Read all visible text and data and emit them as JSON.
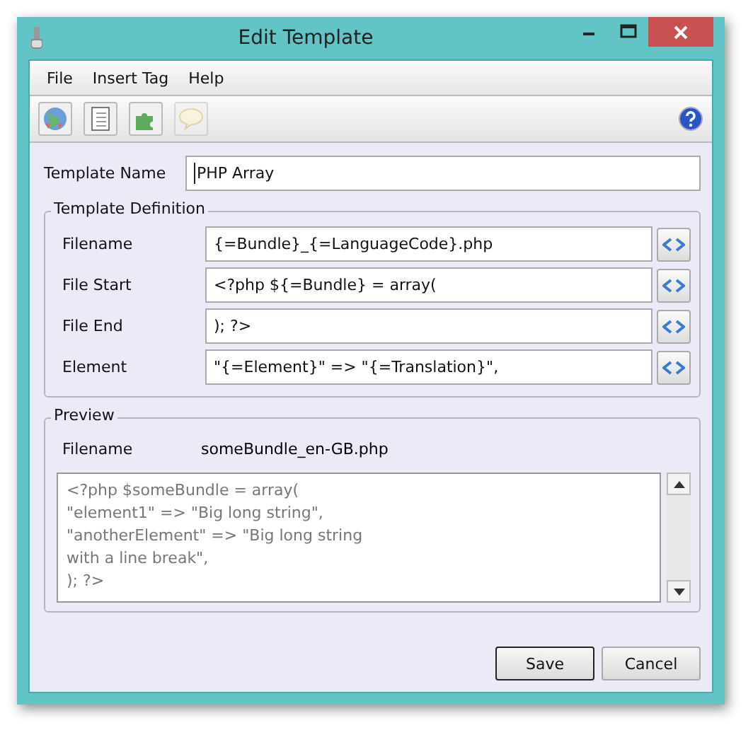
{
  "window": {
    "title": "Edit Template"
  },
  "menu": [
    "File",
    "Insert Tag",
    "Help"
  ],
  "toolbar": [
    {
      "kind": "globe",
      "disabled": false
    },
    {
      "kind": "notes",
      "disabled": false
    },
    {
      "kind": "puzzle",
      "disabled": false
    },
    {
      "kind": "speech",
      "disabled": true
    }
  ],
  "template_name": {
    "label": "Template Name",
    "value": "PHP Array"
  },
  "definition": {
    "title": "Template Definition",
    "fields": [
      {
        "label": "Filename",
        "value": "{=Bundle}_{=LanguageCode}.php"
      },
      {
        "label": "File Start",
        "value": "<?php ${=Bundle} = array("
      },
      {
        "label": "File End",
        "value": "); ?>"
      },
      {
        "label": "Element",
        "value": "\"{=Element}\" => \"{=Translation}\","
      }
    ]
  },
  "preview": {
    "title": "Preview",
    "filename_label": "Filename",
    "filename": "someBundle_en-GB.php",
    "lines": [
      "<?php $someBundle = array(",
      "\"element1\" => \"Big long string\",",
      "\"anotherElement\" => \"Big long string",
      "with a line break\",",
      "); ?>"
    ]
  },
  "buttons": [
    {
      "label": "Save",
      "kind": "default"
    },
    {
      "label": "Cancel",
      "kind": "normal"
    }
  ]
}
